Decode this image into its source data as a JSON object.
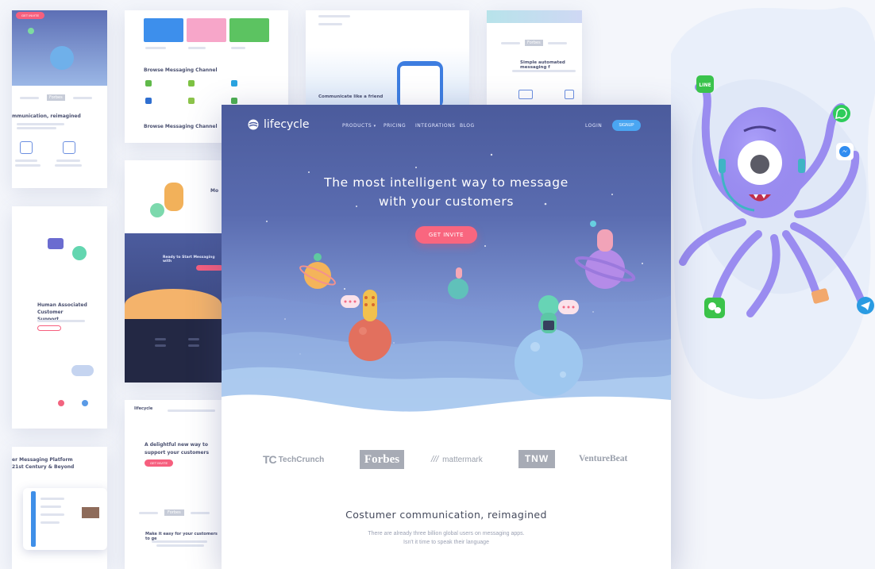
{
  "hero": {
    "logo_text": "lifecycle",
    "nav": [
      "PRODUCTS",
      "PRICING",
      "INTEGRATIONS",
      "BLOG"
    ],
    "nav_caret": "▾",
    "login": "LOGIN",
    "signup": "SIGNUP",
    "headline_line1": "The most intelligent way to message",
    "headline_line2": "with your customers",
    "cta": "GET INVITE"
  },
  "press": [
    "TechCrunch",
    "Forbes",
    "mattermark",
    "TNW",
    "VentureBeat"
  ],
  "press_marks": {
    "techcrunch": "TC",
    "mattermark": "///"
  },
  "section": {
    "title": "Costumer communication, reimagined",
    "text_line1": "There are already three billion global users on messaging apps.",
    "text_line2": "Isn't it time to speak their language"
  },
  "left_col_1": {
    "press_logo": "Forbes",
    "title": "mmunication, reimagined",
    "tag": "GET INVITE"
  },
  "left_col_2": {
    "title_line1": "Human Associated Customer",
    "title_line2": "Support"
  },
  "left_col_3": {
    "title_line1": "er Messaging Platform",
    "title_line2": "21st Century & Beyond"
  },
  "col2_top": {
    "section_title": "Browse Messaging Channel",
    "footer_title": "Browse Messaging Channel"
  },
  "col2_mid": {
    "title": "Ready to Start Messaging with",
    "side_text": "Mo"
  },
  "col2_bottom": {
    "logo": "lifecycle",
    "headline_line1": "A delightful new way to",
    "headline_line2": "support your customers",
    "cta": "GET INVITE",
    "press": "Forbes",
    "caption": "Make it easy for your customers to ge"
  },
  "col3_top": {
    "caption": "Communicate like a friend"
  },
  "col4_top": {
    "title": "Simple automated messaging f",
    "press": "Forbes"
  },
  "app_icons": {
    "line": "LINE"
  },
  "colors": {
    "hero_top": "#4b5b9c",
    "hero_bottom": "#bcd6f2",
    "cta": "#f9667f",
    "signup": "#4aa6f2",
    "octopus": "#9a8cf0"
  }
}
